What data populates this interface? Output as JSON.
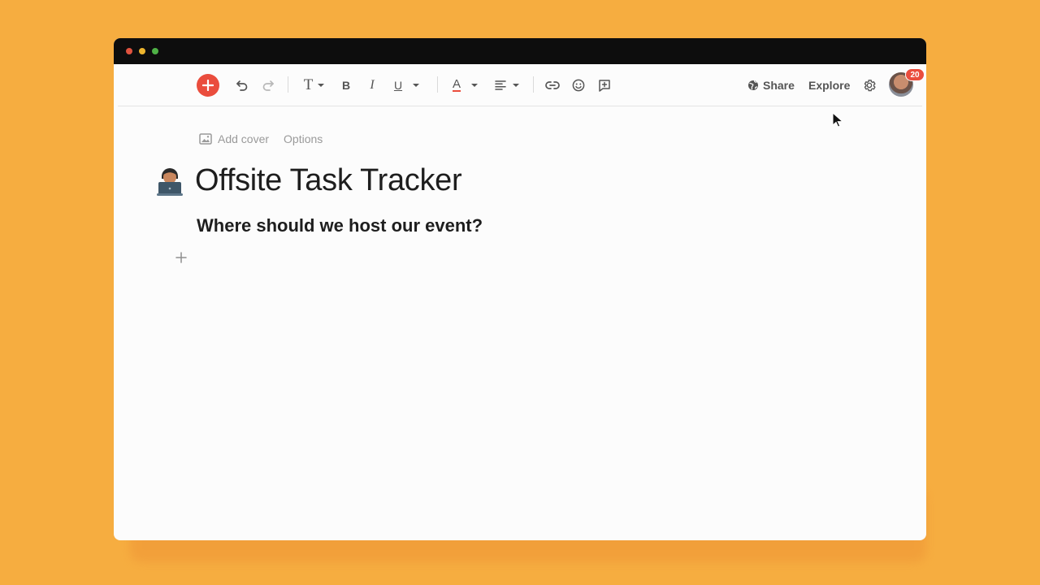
{
  "toolbar": {
    "share_label": "Share",
    "explore_label": "Explore",
    "notification_count": "20",
    "icons": [
      "plus-icon",
      "undo-icon",
      "redo-icon",
      "text-style-icon",
      "bold-icon",
      "italic-icon",
      "underline-icon",
      "text-color-icon",
      "align-icon",
      "link-icon",
      "emoji-icon",
      "comment-icon",
      "globe-icon",
      "gear-icon"
    ],
    "bold_glyph": "B",
    "italic_glyph": "I",
    "underline_glyph": "U",
    "text_glyph": "T",
    "color_glyph": "A"
  },
  "doc": {
    "add_cover_label": "Add cover",
    "options_label": "Options",
    "title": "Offsite Task Tracker",
    "heading": "Where should we host our event?"
  },
  "colors": {
    "background": "#F6AD40",
    "accent": "#EA4D3D",
    "window_bar": "#0D0D0D"
  }
}
